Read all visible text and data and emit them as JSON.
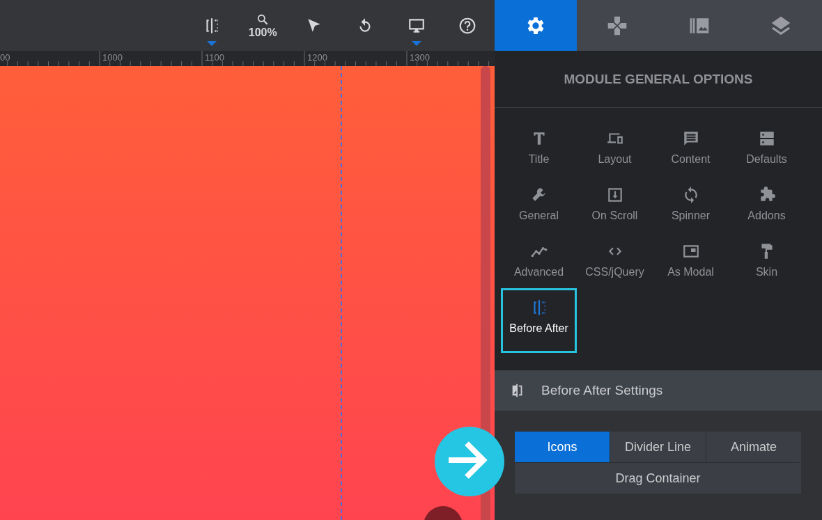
{
  "toolbar": {
    "tools": [
      {
        "kind": "split",
        "has_menu": true
      },
      {
        "kind": "zoom",
        "label": "100%",
        "has_menu": false
      },
      {
        "kind": "pointer",
        "has_menu": false
      },
      {
        "kind": "undo",
        "has_menu": false
      },
      {
        "kind": "monitor",
        "has_menu": true
      },
      {
        "kind": "help",
        "has_menu": false
      }
    ]
  },
  "ruler": {
    "labels": [
      "00",
      "1000",
      "1100",
      "1200",
      "1300"
    ]
  },
  "panel_tabs": [
    {
      "kind": "settings",
      "selected": true
    },
    {
      "kind": "gamepad",
      "selected": false
    },
    {
      "kind": "library",
      "selected": false
    },
    {
      "kind": "layers",
      "selected": false
    }
  ],
  "panel": {
    "title": "MODULE GENERAL OPTIONS",
    "options": [
      {
        "label": "Title",
        "selected": false
      },
      {
        "label": "Layout",
        "selected": false
      },
      {
        "label": "Content",
        "selected": false
      },
      {
        "label": "Defaults",
        "selected": false
      },
      {
        "label": "General",
        "selected": false
      },
      {
        "label": "On Scroll",
        "selected": false
      },
      {
        "label": "Spinner",
        "selected": false
      },
      {
        "label": "Addons",
        "selected": false
      },
      {
        "label": "Advanced",
        "selected": false
      },
      {
        "label": "CSS/jQuery",
        "selected": false
      },
      {
        "label": "As Modal",
        "selected": false
      },
      {
        "label": "Skin",
        "selected": false
      },
      {
        "label": "Before After",
        "selected": true
      }
    ],
    "section": {
      "title": "Before After Settings",
      "buttons": [
        {
          "label": "Icons",
          "selected": true
        },
        {
          "label": "Divider Line",
          "selected": false
        },
        {
          "label": "Animate",
          "selected": false
        },
        {
          "label": "Drag Container",
          "selected": false
        }
      ]
    }
  }
}
